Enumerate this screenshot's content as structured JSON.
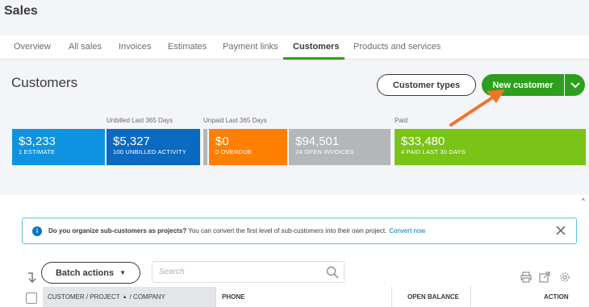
{
  "app": {
    "title": "Sales"
  },
  "tabs": [
    {
      "label": "Overview"
    },
    {
      "label": "All sales"
    },
    {
      "label": "Invoices"
    },
    {
      "label": "Estimates"
    },
    {
      "label": "Payment links"
    },
    {
      "label": "Customers"
    },
    {
      "label": "Products and services"
    }
  ],
  "active_tab": "Customers",
  "header": {
    "title": "Customers",
    "customer_types_label": "Customer types",
    "new_customer_label": "New customer"
  },
  "summary": {
    "unbilled_label": "Unbilled Last 365 Days",
    "unpaid_label": "Unpaid Last 365 Days",
    "paid_label": "Paid",
    "tiles": [
      {
        "amount": "$3,233",
        "sub": "1 ESTIMATE",
        "color": "#0d93e0"
      },
      {
        "amount": "$5,327",
        "sub": "100 UNBILLED ACTIVITY",
        "color": "#0a6ac1"
      },
      {
        "amount": "$0",
        "sub": "0 OVERDUE",
        "color": "#ff8000"
      },
      {
        "amount": "$94,501",
        "sub": "24 OPEN INVOICES",
        "color": "#b4b6ba"
      },
      {
        "amount": "$33,480",
        "sub": "4 PAID LAST 30 DAYS",
        "color": "#7ac417"
      }
    ]
  },
  "banner": {
    "bold": "Do you organize sub-customers as projects?",
    "text": " You can convert the first level of sub-customers into their own project.",
    "link": "Convert now"
  },
  "toolbar": {
    "batch_label": "Batch actions",
    "search_placeholder": "Search"
  },
  "table": {
    "columns": {
      "customer": "CUSTOMER / PROJECT",
      "company": "/ COMPANY",
      "phone": "PHONE",
      "open_balance": "OPEN BALANCE",
      "action": "ACTION"
    }
  },
  "colors": {
    "accent_green": "#2ca01c",
    "arrow_orange": "#f07428",
    "link_blue": "#0077c5"
  }
}
